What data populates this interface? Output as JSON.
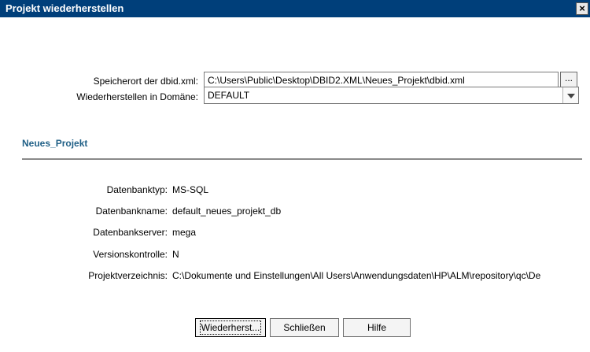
{
  "window": {
    "title": "Projekt wiederherstellen",
    "close_glyph": "×"
  },
  "form": {
    "location_label": "Speicherort der dbid.xml:",
    "location_value": "C:\\Users\\Public\\Desktop\\DBID2.XML\\Neues_Projekt\\dbid.xml",
    "browse_label": "...",
    "domain_label": "Wiederherstellen in Domäne:",
    "domain_value": "DEFAULT"
  },
  "project": {
    "name": "Neues_Projekt",
    "details": [
      {
        "label": "Datenbanktyp:",
        "value": "MS-SQL"
      },
      {
        "label": "Datenbankname:",
        "value": "default_neues_projekt_db"
      },
      {
        "label": "Datenbankserver:",
        "value": "mega"
      },
      {
        "label": "Versionskontrolle:",
        "value": "N"
      },
      {
        "label": "Projektverzeichnis:",
        "value": "C:\\Dokumente und Einstellungen\\All Users\\Anwendungsdaten\\HP\\ALM\\repository\\qc\\De"
      }
    ]
  },
  "buttons": {
    "restore": "Wiederherst...",
    "close": "Schließen",
    "help": "Hilfe"
  },
  "colors": {
    "titlebar": "#003f7a",
    "section_title": "#1f5f86"
  },
  "icons": {
    "close": "close-icon",
    "dropdown": "chevron-down-icon"
  }
}
